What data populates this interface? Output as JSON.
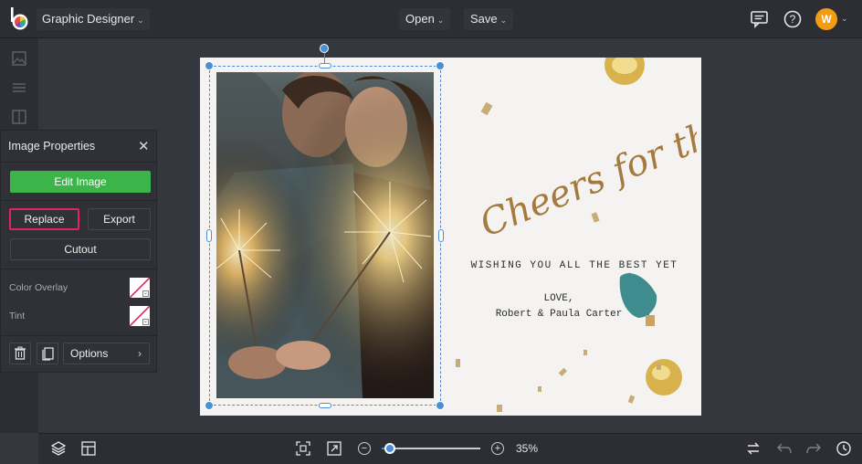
{
  "header": {
    "app_switcher_label": "Graphic Designer",
    "open_label": "Open",
    "save_label": "Save",
    "avatar_initial": "W",
    "icons": [
      "logo-icon",
      "chat-icon",
      "help-icon"
    ]
  },
  "panel": {
    "title": "Image Properties",
    "edit_image_label": "Edit Image",
    "replace_label": "Replace",
    "export_label": "Export",
    "cutout_label": "Cutout",
    "color_overlay_label": "Color Overlay",
    "tint_label": "Tint",
    "options_label": "Options",
    "accent_green": "#3bb54a",
    "highlight_color": "#e0245e"
  },
  "canvas": {
    "headline": "Cheers for the New year",
    "wishing": "WISHING YOU ALL THE BEST YET",
    "love": "LOVE,",
    "names": "Robert & Paula Carter"
  },
  "footer": {
    "zoom_label": "35%",
    "zoom_fraction": 0.08
  }
}
